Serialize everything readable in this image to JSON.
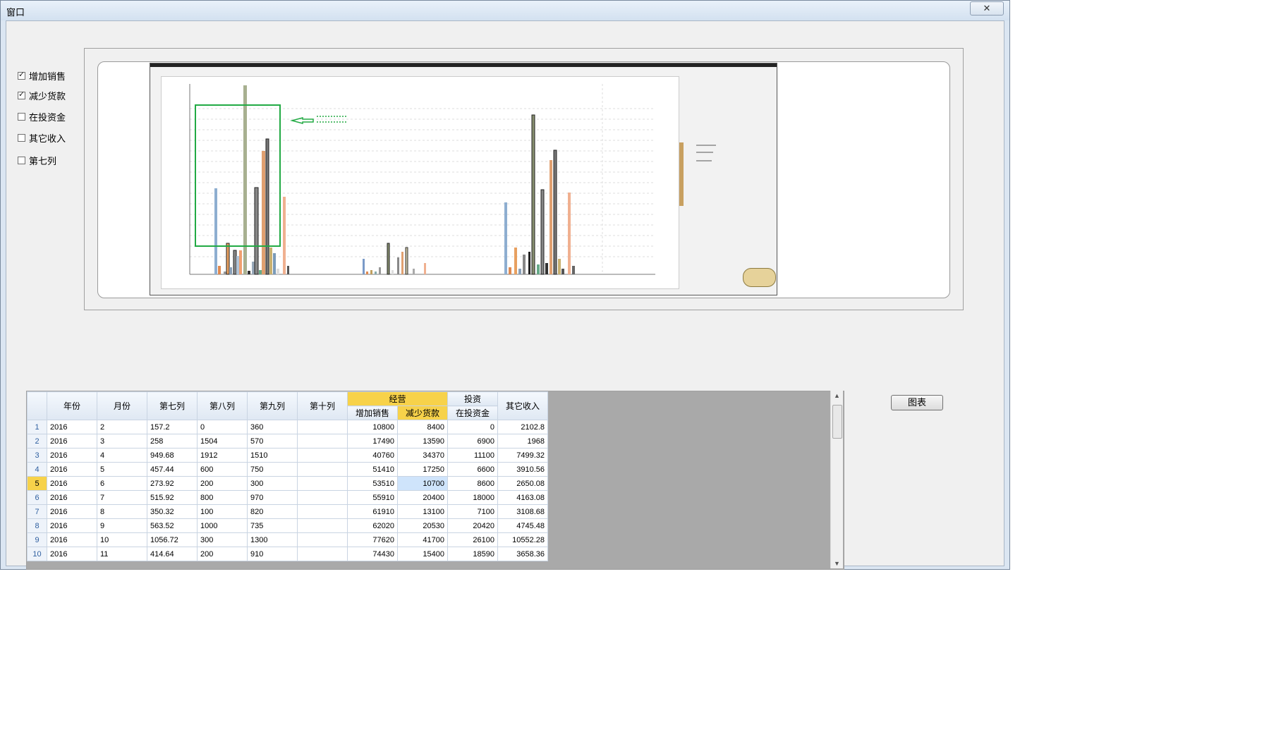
{
  "window": {
    "title": "窗口",
    "close_icon": "close-icon"
  },
  "checkboxes": [
    {
      "label": "增加销售",
      "checked": true
    },
    {
      "label": "减少货款",
      "checked": true
    },
    {
      "label": "在投资金",
      "checked": false
    },
    {
      "label": "其它收入",
      "checked": false
    },
    {
      "label": "第七列",
      "checked": false
    }
  ],
  "chart_button": "图表",
  "table": {
    "headers": [
      "年份",
      "月份",
      "第七列",
      "第八列",
      "第九列",
      "第十列"
    ],
    "group_jingying": "经营",
    "group_touzi": "投资",
    "sub_headers": [
      "增加销售",
      "减少货款",
      "在投资金"
    ],
    "other_income": "其它收入",
    "rows": [
      [
        "1",
        "2016",
        "2",
        "157.2",
        "0",
        "360",
        "",
        "10800",
        "8400",
        "0",
        "2102.8"
      ],
      [
        "2",
        "2016",
        "3",
        "258",
        "1504",
        "570",
        "",
        "17490",
        "13590",
        "6900",
        "1968"
      ],
      [
        "3",
        "2016",
        "4",
        "949.68",
        "1912",
        "1510",
        "",
        "40760",
        "34370",
        "11100",
        "7499.32"
      ],
      [
        "4",
        "2016",
        "5",
        "457.44",
        "600",
        "750",
        "",
        "51410",
        "17250",
        "6600",
        "3910.56"
      ],
      [
        "5",
        "2016",
        "6",
        "273.92",
        "200",
        "300",
        "",
        "53510",
        "10700",
        "8600",
        "2650.08"
      ],
      [
        "6",
        "2016",
        "7",
        "515.92",
        "800",
        "970",
        "",
        "55910",
        "20400",
        "18000",
        "4163.08"
      ],
      [
        "7",
        "2016",
        "8",
        "350.32",
        "100",
        "820",
        "",
        "61910",
        "13100",
        "7100",
        "3108.68"
      ],
      [
        "8",
        "2016",
        "9",
        "563.52",
        "1000",
        "735",
        "",
        "62020",
        "20530",
        "20420",
        "4745.48"
      ],
      [
        "9",
        "2016",
        "10",
        "1056.72",
        "300",
        "1300",
        "",
        "77620",
        "41700",
        "26100",
        "10552.28"
      ],
      [
        "10",
        "2016",
        "11",
        "414.64",
        "200",
        "910",
        "",
        "74430",
        "15400",
        "18590",
        "3658.36"
      ]
    ]
  },
  "colors": {
    "highlight": "#f7d24a",
    "selection": "#cfe4fb",
    "green_box": "#22aa44"
  }
}
